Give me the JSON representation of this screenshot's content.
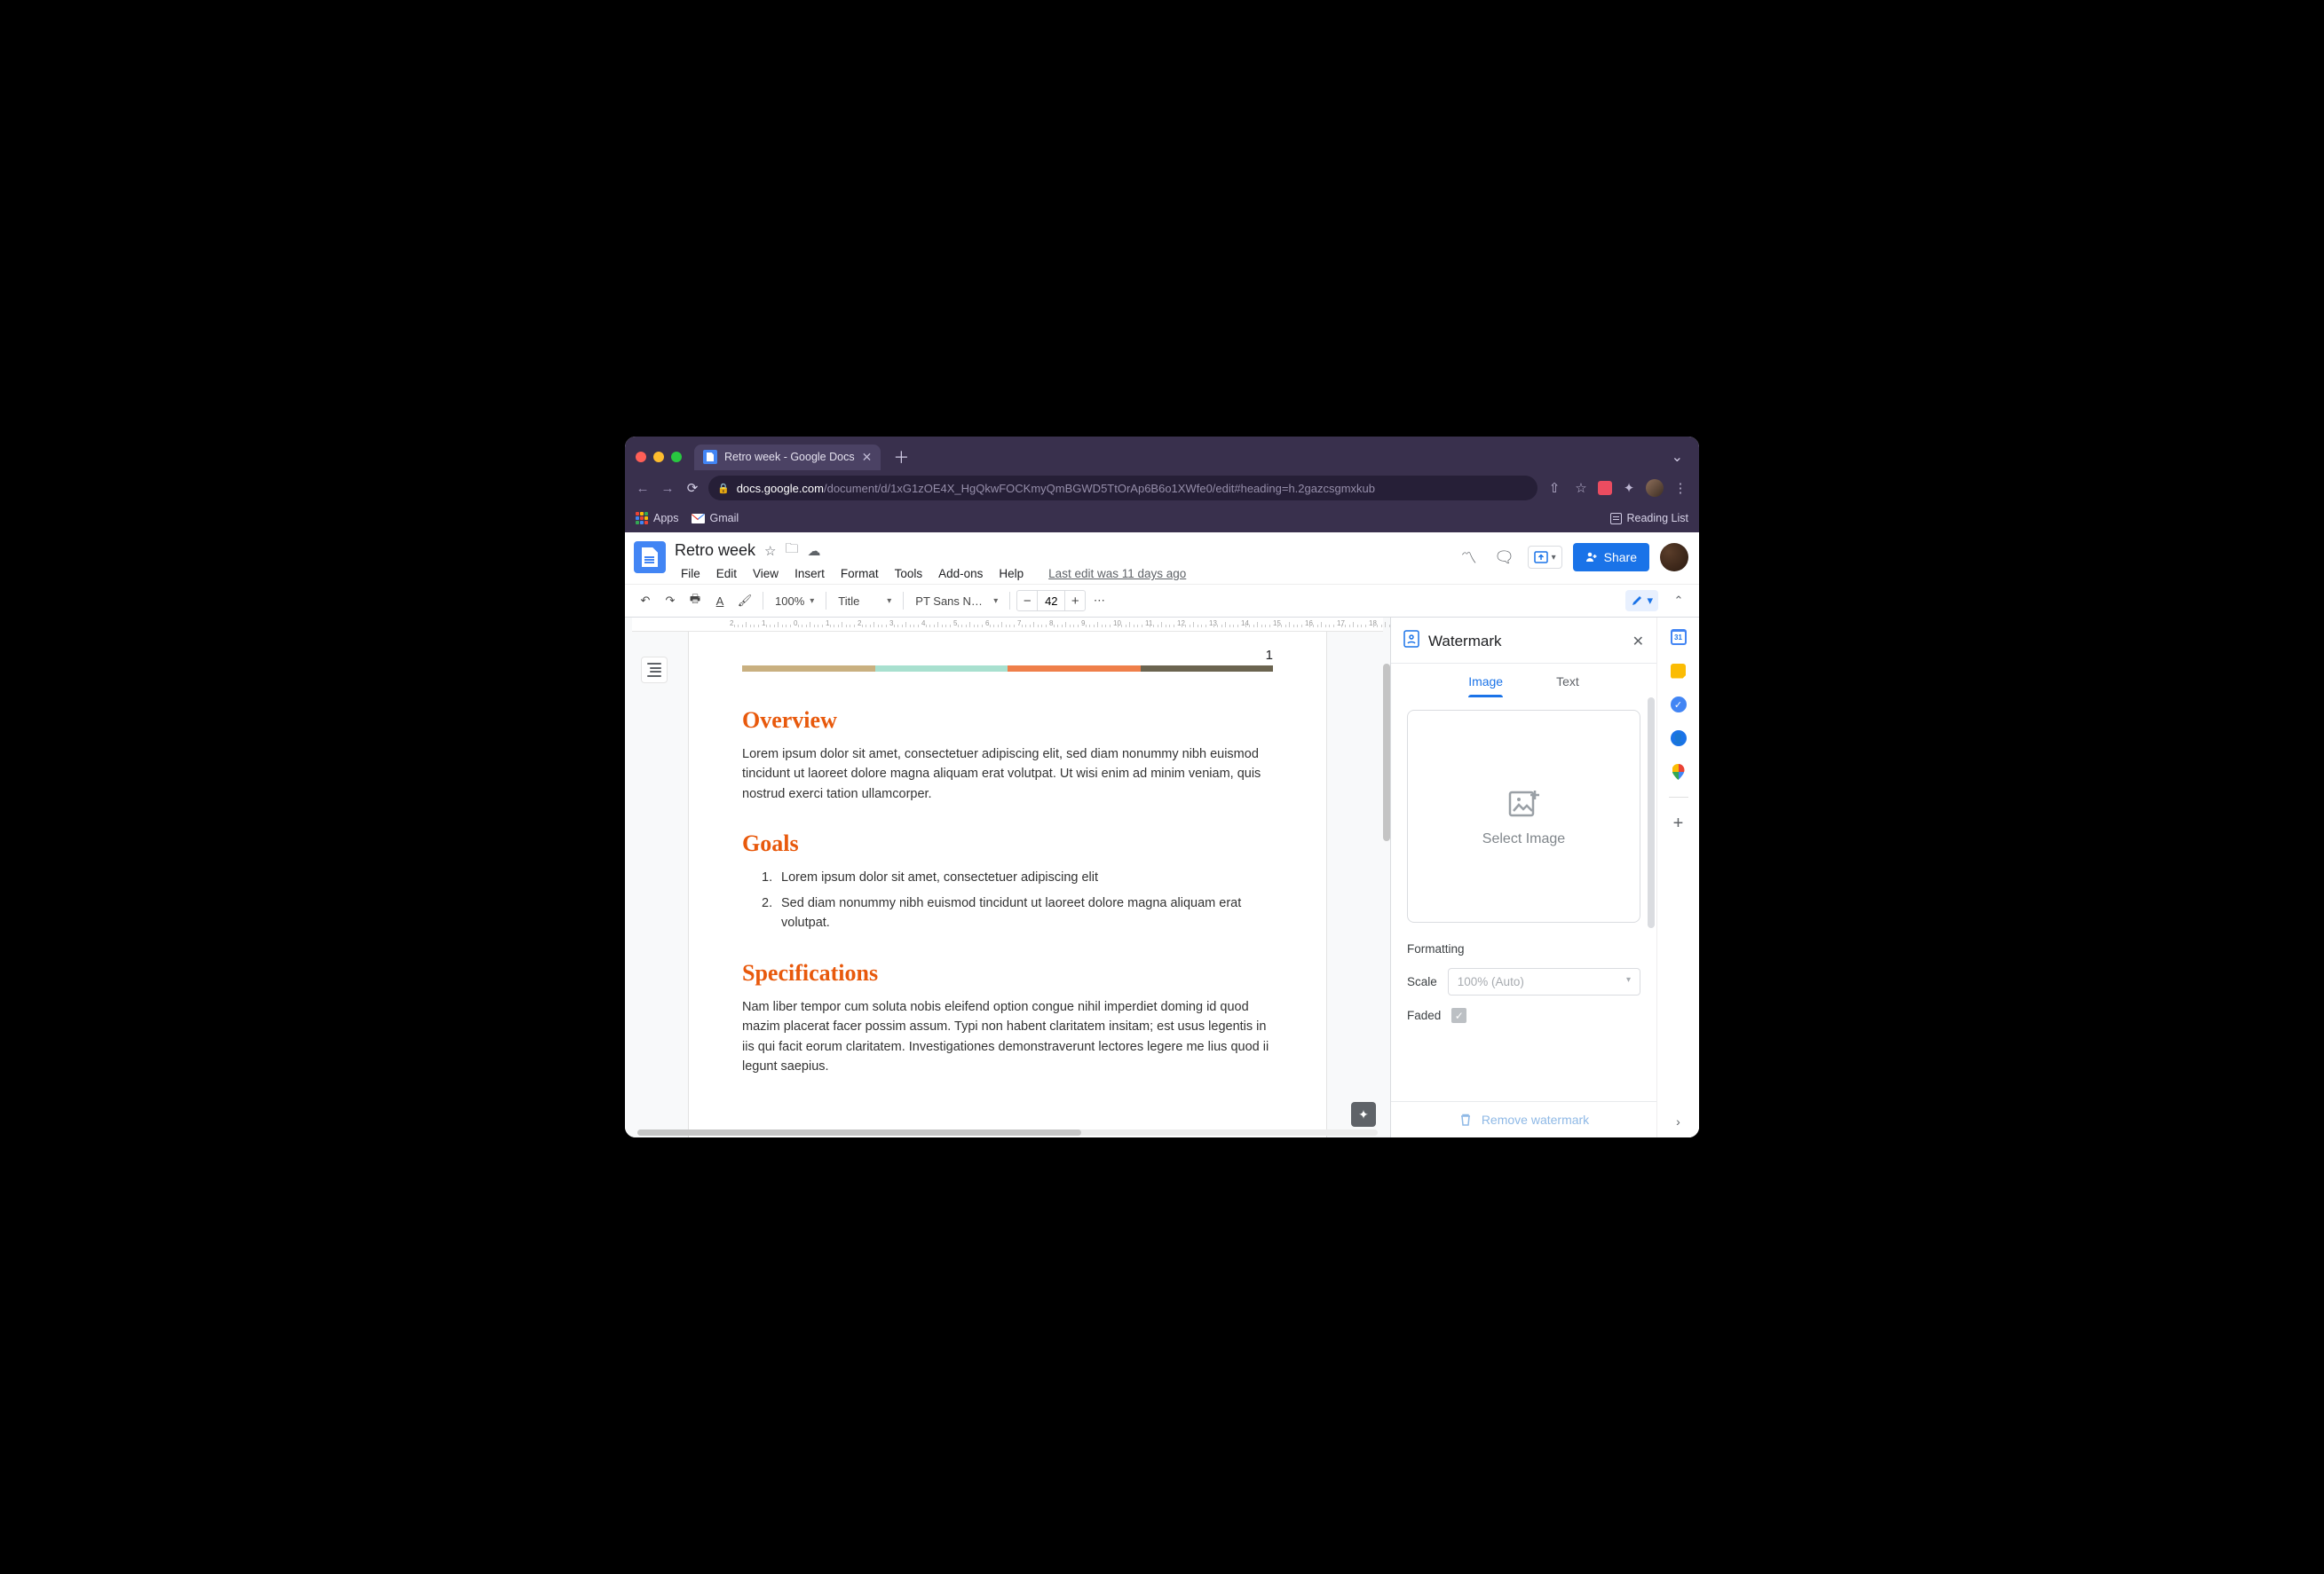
{
  "browser": {
    "tab_title": "Retro week - Google Docs",
    "url_host": "docs.google.com",
    "url_path": "/document/d/1xG1zOE4X_HgQkwFOCKmyQmBGWD5TtOrAp6B6o1XWfe0/edit#heading=h.2gazcsgmxkub",
    "bookmarks": {
      "apps": "Apps",
      "gmail": "Gmail",
      "reading": "Reading List"
    }
  },
  "docs": {
    "title": "Retro week",
    "menus": [
      "File",
      "Edit",
      "View",
      "Insert",
      "Format",
      "Tools",
      "Add-ons",
      "Help"
    ],
    "last_edit": "Last edit was 11 days ago",
    "share": "Share",
    "toolbar": {
      "zoom": "100%",
      "style": "Title",
      "font": "PT Sans N…",
      "font_size": "42"
    }
  },
  "document": {
    "page_number": "1",
    "colors": [
      "#c9b080",
      "#a8e0cf",
      "#ef7f4a",
      "#6b6450"
    ],
    "sections": [
      {
        "heading": "Overview",
        "body": "Lorem ipsum dolor sit amet, consectetuer adipiscing elit, sed diam nonummy nibh euismod tincidunt ut laoreet dolore magna aliquam erat volutpat. Ut wisi enim ad minim veniam, quis nostrud exerci tation ullamcorper."
      },
      {
        "heading": "Goals",
        "list": [
          "Lorem ipsum dolor sit amet, consectetuer adipiscing elit",
          "Sed diam nonummy nibh euismod tincidunt ut laoreet dolore magna aliquam erat volutpat."
        ]
      },
      {
        "heading": "Specifications",
        "body": "Nam liber tempor cum soluta nobis eleifend option congue nihil imperdiet doming id quod mazim placerat facer possim assum. Typi non habent claritatem insitam; est usus legentis in iis qui facit eorum claritatem. Investigationes demonstraverunt lectores legere me lius quod ii legunt saepius."
      }
    ]
  },
  "watermark": {
    "title": "Watermark",
    "tabs": {
      "image": "Image",
      "text": "Text"
    },
    "select_image": "Select Image",
    "formatting_label": "Formatting",
    "scale_label": "Scale",
    "scale_value": "100% (Auto)",
    "faded_label": "Faded",
    "remove_label": "Remove watermark"
  }
}
